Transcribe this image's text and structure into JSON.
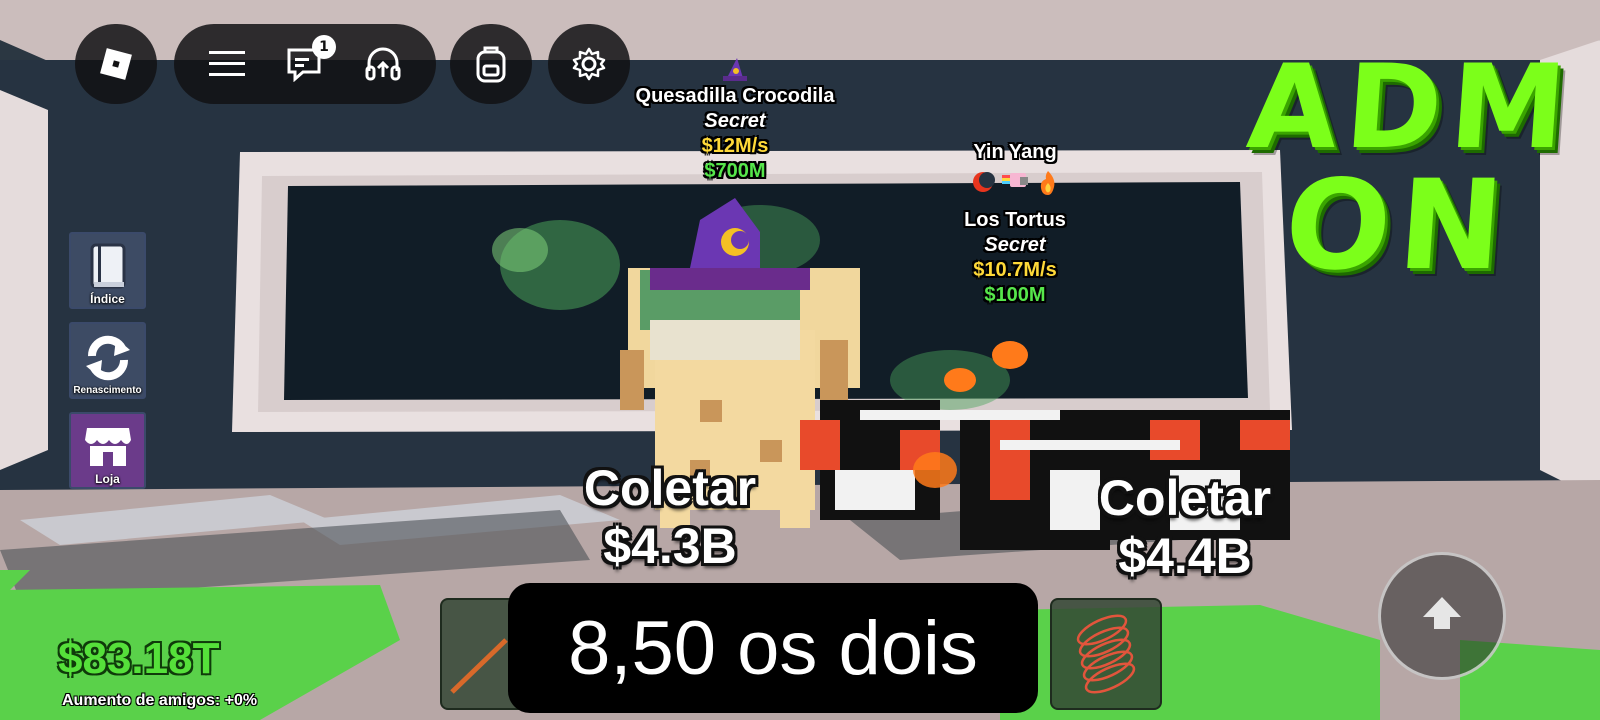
{
  "topbar": {
    "roblox_menu_icon": "roblox-logo-icon",
    "hamburger_icon": "hamburger-menu-icon",
    "chat_icon": "chat-icon",
    "chat_badge": "1",
    "voice_icon": "headset-icon",
    "backpack_icon": "backpack-icon",
    "settings_icon": "gear-icon"
  },
  "sidebar": {
    "items": [
      {
        "label": "Índice",
        "icon": "book-icon"
      },
      {
        "label": "Renascimento",
        "icon": "refresh-icon"
      },
      {
        "label": "Loja",
        "icon": "shop-icon"
      }
    ]
  },
  "billboards": [
    {
      "name": "Quesadilla Crocodila",
      "rarity": "Secret",
      "rate": "$12M/s",
      "price": "$700M"
    },
    {
      "owner": "Yin Yang",
      "name": "Los Tortus",
      "rarity": "Secret",
      "rate": "$10.7M/s",
      "price": "$100M"
    }
  ],
  "collect": [
    {
      "label": "Coletar",
      "amount": "$4.3B"
    },
    {
      "label": "Coletar",
      "amount": "$4.4B"
    }
  ],
  "overlay": {
    "line1": "ADM",
    "line2": "ON"
  },
  "hud": {
    "money": "$83.18T",
    "friends_boost": "Aumento de amigos: +0%",
    "caption": "8,50 os dois",
    "jump_icon": "jump-arrow-icon"
  },
  "colors": {
    "money_green": "#55e03a",
    "adm_green": "#7cff1a",
    "rate_yellow": "#ffd938",
    "loja_purple": "#6b3b8a"
  }
}
